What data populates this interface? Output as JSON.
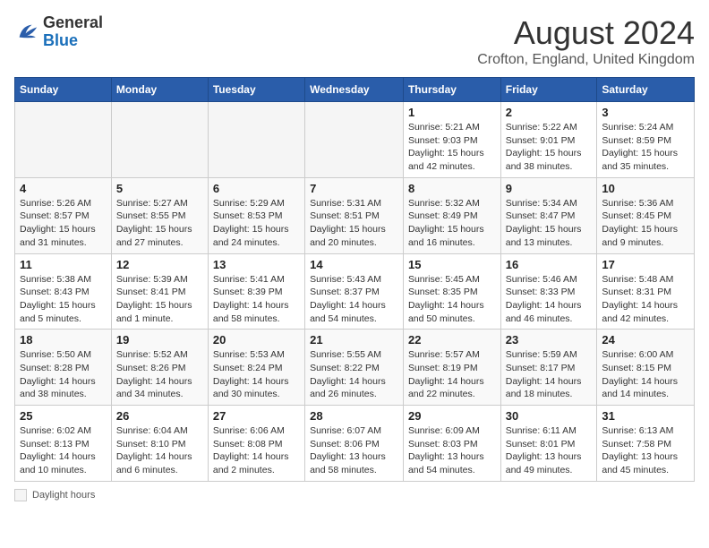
{
  "header": {
    "logo_general": "General",
    "logo_blue": "Blue",
    "month_year": "August 2024",
    "location": "Crofton, England, United Kingdom"
  },
  "weekdays": [
    "Sunday",
    "Monday",
    "Tuesday",
    "Wednesday",
    "Thursday",
    "Friday",
    "Saturday"
  ],
  "footer": {
    "label": "Daylight hours"
  },
  "weeks": [
    [
      {
        "day": "",
        "info": ""
      },
      {
        "day": "",
        "info": ""
      },
      {
        "day": "",
        "info": ""
      },
      {
        "day": "",
        "info": ""
      },
      {
        "day": "1",
        "info": "Sunrise: 5:21 AM\nSunset: 9:03 PM\nDaylight: 15 hours\nand 42 minutes."
      },
      {
        "day": "2",
        "info": "Sunrise: 5:22 AM\nSunset: 9:01 PM\nDaylight: 15 hours\nand 38 minutes."
      },
      {
        "day": "3",
        "info": "Sunrise: 5:24 AM\nSunset: 8:59 PM\nDaylight: 15 hours\nand 35 minutes."
      }
    ],
    [
      {
        "day": "4",
        "info": "Sunrise: 5:26 AM\nSunset: 8:57 PM\nDaylight: 15 hours\nand 31 minutes."
      },
      {
        "day": "5",
        "info": "Sunrise: 5:27 AM\nSunset: 8:55 PM\nDaylight: 15 hours\nand 27 minutes."
      },
      {
        "day": "6",
        "info": "Sunrise: 5:29 AM\nSunset: 8:53 PM\nDaylight: 15 hours\nand 24 minutes."
      },
      {
        "day": "7",
        "info": "Sunrise: 5:31 AM\nSunset: 8:51 PM\nDaylight: 15 hours\nand 20 minutes."
      },
      {
        "day": "8",
        "info": "Sunrise: 5:32 AM\nSunset: 8:49 PM\nDaylight: 15 hours\nand 16 minutes."
      },
      {
        "day": "9",
        "info": "Sunrise: 5:34 AM\nSunset: 8:47 PM\nDaylight: 15 hours\nand 13 minutes."
      },
      {
        "day": "10",
        "info": "Sunrise: 5:36 AM\nSunset: 8:45 PM\nDaylight: 15 hours\nand 9 minutes."
      }
    ],
    [
      {
        "day": "11",
        "info": "Sunrise: 5:38 AM\nSunset: 8:43 PM\nDaylight: 15 hours\nand 5 minutes."
      },
      {
        "day": "12",
        "info": "Sunrise: 5:39 AM\nSunset: 8:41 PM\nDaylight: 15 hours\nand 1 minute."
      },
      {
        "day": "13",
        "info": "Sunrise: 5:41 AM\nSunset: 8:39 PM\nDaylight: 14 hours\nand 58 minutes."
      },
      {
        "day": "14",
        "info": "Sunrise: 5:43 AM\nSunset: 8:37 PM\nDaylight: 14 hours\nand 54 minutes."
      },
      {
        "day": "15",
        "info": "Sunrise: 5:45 AM\nSunset: 8:35 PM\nDaylight: 14 hours\nand 50 minutes."
      },
      {
        "day": "16",
        "info": "Sunrise: 5:46 AM\nSunset: 8:33 PM\nDaylight: 14 hours\nand 46 minutes."
      },
      {
        "day": "17",
        "info": "Sunrise: 5:48 AM\nSunset: 8:31 PM\nDaylight: 14 hours\nand 42 minutes."
      }
    ],
    [
      {
        "day": "18",
        "info": "Sunrise: 5:50 AM\nSunset: 8:28 PM\nDaylight: 14 hours\nand 38 minutes."
      },
      {
        "day": "19",
        "info": "Sunrise: 5:52 AM\nSunset: 8:26 PM\nDaylight: 14 hours\nand 34 minutes."
      },
      {
        "day": "20",
        "info": "Sunrise: 5:53 AM\nSunset: 8:24 PM\nDaylight: 14 hours\nand 30 minutes."
      },
      {
        "day": "21",
        "info": "Sunrise: 5:55 AM\nSunset: 8:22 PM\nDaylight: 14 hours\nand 26 minutes."
      },
      {
        "day": "22",
        "info": "Sunrise: 5:57 AM\nSunset: 8:19 PM\nDaylight: 14 hours\nand 22 minutes."
      },
      {
        "day": "23",
        "info": "Sunrise: 5:59 AM\nSunset: 8:17 PM\nDaylight: 14 hours\nand 18 minutes."
      },
      {
        "day": "24",
        "info": "Sunrise: 6:00 AM\nSunset: 8:15 PM\nDaylight: 14 hours\nand 14 minutes."
      }
    ],
    [
      {
        "day": "25",
        "info": "Sunrise: 6:02 AM\nSunset: 8:13 PM\nDaylight: 14 hours\nand 10 minutes."
      },
      {
        "day": "26",
        "info": "Sunrise: 6:04 AM\nSunset: 8:10 PM\nDaylight: 14 hours\nand 6 minutes."
      },
      {
        "day": "27",
        "info": "Sunrise: 6:06 AM\nSunset: 8:08 PM\nDaylight: 14 hours\nand 2 minutes."
      },
      {
        "day": "28",
        "info": "Sunrise: 6:07 AM\nSunset: 8:06 PM\nDaylight: 13 hours\nand 58 minutes."
      },
      {
        "day": "29",
        "info": "Sunrise: 6:09 AM\nSunset: 8:03 PM\nDaylight: 13 hours\nand 54 minutes."
      },
      {
        "day": "30",
        "info": "Sunrise: 6:11 AM\nSunset: 8:01 PM\nDaylight: 13 hours\nand 49 minutes."
      },
      {
        "day": "31",
        "info": "Sunrise: 6:13 AM\nSunset: 7:58 PM\nDaylight: 13 hours\nand 45 minutes."
      }
    ]
  ]
}
